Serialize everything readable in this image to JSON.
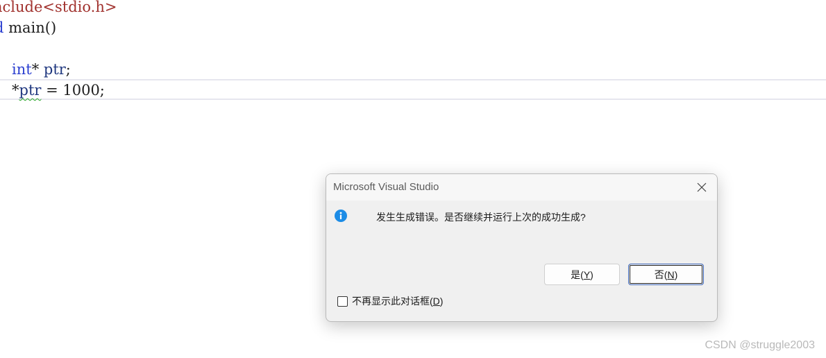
{
  "editor": {
    "lines": [
      {
        "t1": "nclude",
        "t2": "<stdio.h>"
      },
      {
        "t1": "d",
        "t2": " main()"
      },
      {
        "t1": "int",
        "t2": "* ",
        "t3": "ptr",
        "t4": ";"
      },
      {
        "t1": "*",
        "t2": "ptr",
        "t3": " = 1000;"
      }
    ]
  },
  "dialog": {
    "title": "Microsoft Visual Studio",
    "icon": "info-icon",
    "message": "发生生成错误。是否继续并运行上次的成功生成?",
    "buttons": {
      "yes": {
        "text": "是(",
        "accel": "Y",
        "end": ")"
      },
      "no": {
        "text": "否(",
        "accel": "N",
        "end": ")"
      }
    },
    "checkbox": {
      "label": "不再显示此对话框(",
      "accel": "D",
      "end": ")",
      "checked": false
    }
  },
  "watermark": "CSDN @struggle2003",
  "colors": {
    "keyword": "#2b3fd0",
    "include_string": "#a1322e",
    "identifier": "#1f377f",
    "squiggle": "#27a627",
    "info_icon": "#1c8ce6",
    "dialog_bg": "#f0f0f0"
  }
}
